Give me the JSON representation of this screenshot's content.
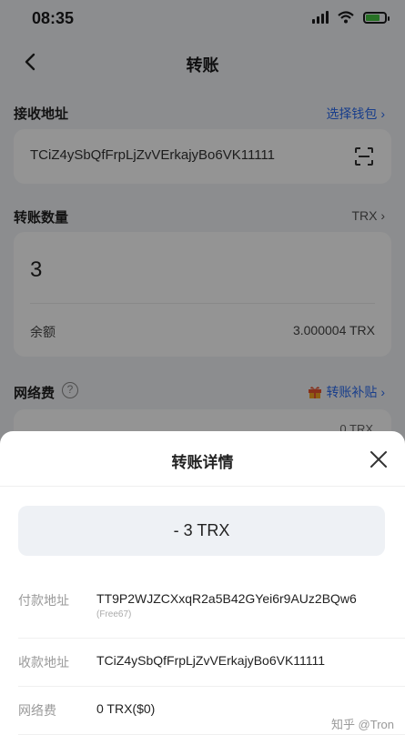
{
  "status": {
    "time": "08:35"
  },
  "nav": {
    "title": "转账"
  },
  "receive": {
    "label": "接收地址",
    "link": "选择钱包 ›",
    "address": "TCiZ4ySbQfFrpLjZvVErkajyBo6VK11111"
  },
  "amount": {
    "label": "转账数量",
    "token": "TRX ›",
    "value": "3",
    "balance_label": "余额",
    "balance_value": "3.000004 TRX"
  },
  "fee": {
    "label": "网络费",
    "help": "?",
    "link": "转账补贴 ›",
    "peek": "0 TRX"
  },
  "sheet": {
    "title": "转账详情",
    "amount": "- 3 TRX",
    "from_label": "付款地址",
    "from_value": "TT9P2WJZCXxqR2a5B42GYei6r9AUz2BQw6",
    "from_sub": "(Free67)",
    "to_label": "收款地址",
    "to_value": "TCiZ4ySbQfFrpLjZvVErkajyBo6VK11111",
    "fee_label": "网络费",
    "fee_value": "0 TRX($0)"
  },
  "watermark": "知乎 @Tron",
  "colors": {
    "accent": "#2b6cf0",
    "battery": "#45c442"
  }
}
